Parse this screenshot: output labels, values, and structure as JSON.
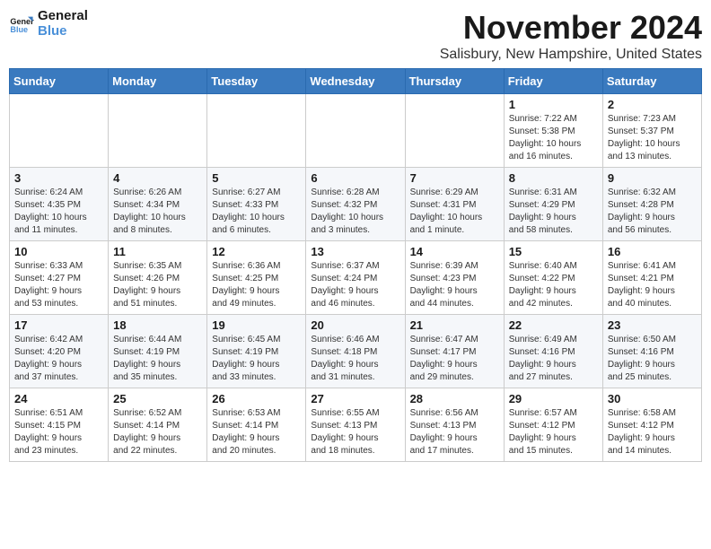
{
  "logo": {
    "line1": "General",
    "line2": "Blue"
  },
  "header": {
    "month": "November 2024",
    "location": "Salisbury, New Hampshire, United States"
  },
  "weekdays": [
    "Sunday",
    "Monday",
    "Tuesday",
    "Wednesday",
    "Thursday",
    "Friday",
    "Saturday"
  ],
  "weeks": [
    [
      {
        "day": "",
        "info": ""
      },
      {
        "day": "",
        "info": ""
      },
      {
        "day": "",
        "info": ""
      },
      {
        "day": "",
        "info": ""
      },
      {
        "day": "",
        "info": ""
      },
      {
        "day": "1",
        "info": "Sunrise: 7:22 AM\nSunset: 5:38 PM\nDaylight: 10 hours\nand 16 minutes."
      },
      {
        "day": "2",
        "info": "Sunrise: 7:23 AM\nSunset: 5:37 PM\nDaylight: 10 hours\nand 13 minutes."
      }
    ],
    [
      {
        "day": "3",
        "info": "Sunrise: 6:24 AM\nSunset: 4:35 PM\nDaylight: 10 hours\nand 11 minutes."
      },
      {
        "day": "4",
        "info": "Sunrise: 6:26 AM\nSunset: 4:34 PM\nDaylight: 10 hours\nand 8 minutes."
      },
      {
        "day": "5",
        "info": "Sunrise: 6:27 AM\nSunset: 4:33 PM\nDaylight: 10 hours\nand 6 minutes."
      },
      {
        "day": "6",
        "info": "Sunrise: 6:28 AM\nSunset: 4:32 PM\nDaylight: 10 hours\nand 3 minutes."
      },
      {
        "day": "7",
        "info": "Sunrise: 6:29 AM\nSunset: 4:31 PM\nDaylight: 10 hours\nand 1 minute."
      },
      {
        "day": "8",
        "info": "Sunrise: 6:31 AM\nSunset: 4:29 PM\nDaylight: 9 hours\nand 58 minutes."
      },
      {
        "day": "9",
        "info": "Sunrise: 6:32 AM\nSunset: 4:28 PM\nDaylight: 9 hours\nand 56 minutes."
      }
    ],
    [
      {
        "day": "10",
        "info": "Sunrise: 6:33 AM\nSunset: 4:27 PM\nDaylight: 9 hours\nand 53 minutes."
      },
      {
        "day": "11",
        "info": "Sunrise: 6:35 AM\nSunset: 4:26 PM\nDaylight: 9 hours\nand 51 minutes."
      },
      {
        "day": "12",
        "info": "Sunrise: 6:36 AM\nSunset: 4:25 PM\nDaylight: 9 hours\nand 49 minutes."
      },
      {
        "day": "13",
        "info": "Sunrise: 6:37 AM\nSunset: 4:24 PM\nDaylight: 9 hours\nand 46 minutes."
      },
      {
        "day": "14",
        "info": "Sunrise: 6:39 AM\nSunset: 4:23 PM\nDaylight: 9 hours\nand 44 minutes."
      },
      {
        "day": "15",
        "info": "Sunrise: 6:40 AM\nSunset: 4:22 PM\nDaylight: 9 hours\nand 42 minutes."
      },
      {
        "day": "16",
        "info": "Sunrise: 6:41 AM\nSunset: 4:21 PM\nDaylight: 9 hours\nand 40 minutes."
      }
    ],
    [
      {
        "day": "17",
        "info": "Sunrise: 6:42 AM\nSunset: 4:20 PM\nDaylight: 9 hours\nand 37 minutes."
      },
      {
        "day": "18",
        "info": "Sunrise: 6:44 AM\nSunset: 4:19 PM\nDaylight: 9 hours\nand 35 minutes."
      },
      {
        "day": "19",
        "info": "Sunrise: 6:45 AM\nSunset: 4:19 PM\nDaylight: 9 hours\nand 33 minutes."
      },
      {
        "day": "20",
        "info": "Sunrise: 6:46 AM\nSunset: 4:18 PM\nDaylight: 9 hours\nand 31 minutes."
      },
      {
        "day": "21",
        "info": "Sunrise: 6:47 AM\nSunset: 4:17 PM\nDaylight: 9 hours\nand 29 minutes."
      },
      {
        "day": "22",
        "info": "Sunrise: 6:49 AM\nSunset: 4:16 PM\nDaylight: 9 hours\nand 27 minutes."
      },
      {
        "day": "23",
        "info": "Sunrise: 6:50 AM\nSunset: 4:16 PM\nDaylight: 9 hours\nand 25 minutes."
      }
    ],
    [
      {
        "day": "24",
        "info": "Sunrise: 6:51 AM\nSunset: 4:15 PM\nDaylight: 9 hours\nand 23 minutes."
      },
      {
        "day": "25",
        "info": "Sunrise: 6:52 AM\nSunset: 4:14 PM\nDaylight: 9 hours\nand 22 minutes."
      },
      {
        "day": "26",
        "info": "Sunrise: 6:53 AM\nSunset: 4:14 PM\nDaylight: 9 hours\nand 20 minutes."
      },
      {
        "day": "27",
        "info": "Sunrise: 6:55 AM\nSunset: 4:13 PM\nDaylight: 9 hours\nand 18 minutes."
      },
      {
        "day": "28",
        "info": "Sunrise: 6:56 AM\nSunset: 4:13 PM\nDaylight: 9 hours\nand 17 minutes."
      },
      {
        "day": "29",
        "info": "Sunrise: 6:57 AM\nSunset: 4:12 PM\nDaylight: 9 hours\nand 15 minutes."
      },
      {
        "day": "30",
        "info": "Sunrise: 6:58 AM\nSunset: 4:12 PM\nDaylight: 9 hours\nand 14 minutes."
      }
    ]
  ]
}
